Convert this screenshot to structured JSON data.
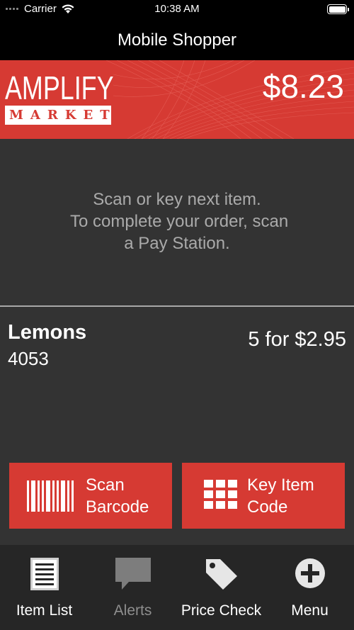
{
  "status_bar": {
    "carrier": "Carrier",
    "time": "10:38 AM"
  },
  "nav": {
    "title": "Mobile Shopper"
  },
  "banner": {
    "logo_top": "AMPLIFY",
    "logo_bottom": "MARKET",
    "total": "$8.23",
    "color": "#d63a33"
  },
  "prompt": {
    "message": "Scan or key next item.\n To complete your order, scan\na Pay Station."
  },
  "item": {
    "name": "Lemons",
    "code": "4053",
    "price": "5 for $2.95"
  },
  "actions": {
    "scan_label": "Scan\nBarcode",
    "key_label": "Key Item\nCode"
  },
  "tabs": [
    {
      "label": "Item List",
      "icon": "list-icon"
    },
    {
      "label": "Alerts",
      "icon": "speech-bubble-icon"
    },
    {
      "label": "Price Check",
      "icon": "price-tag-icon"
    },
    {
      "label": "Menu",
      "icon": "plus-circle-icon"
    }
  ]
}
